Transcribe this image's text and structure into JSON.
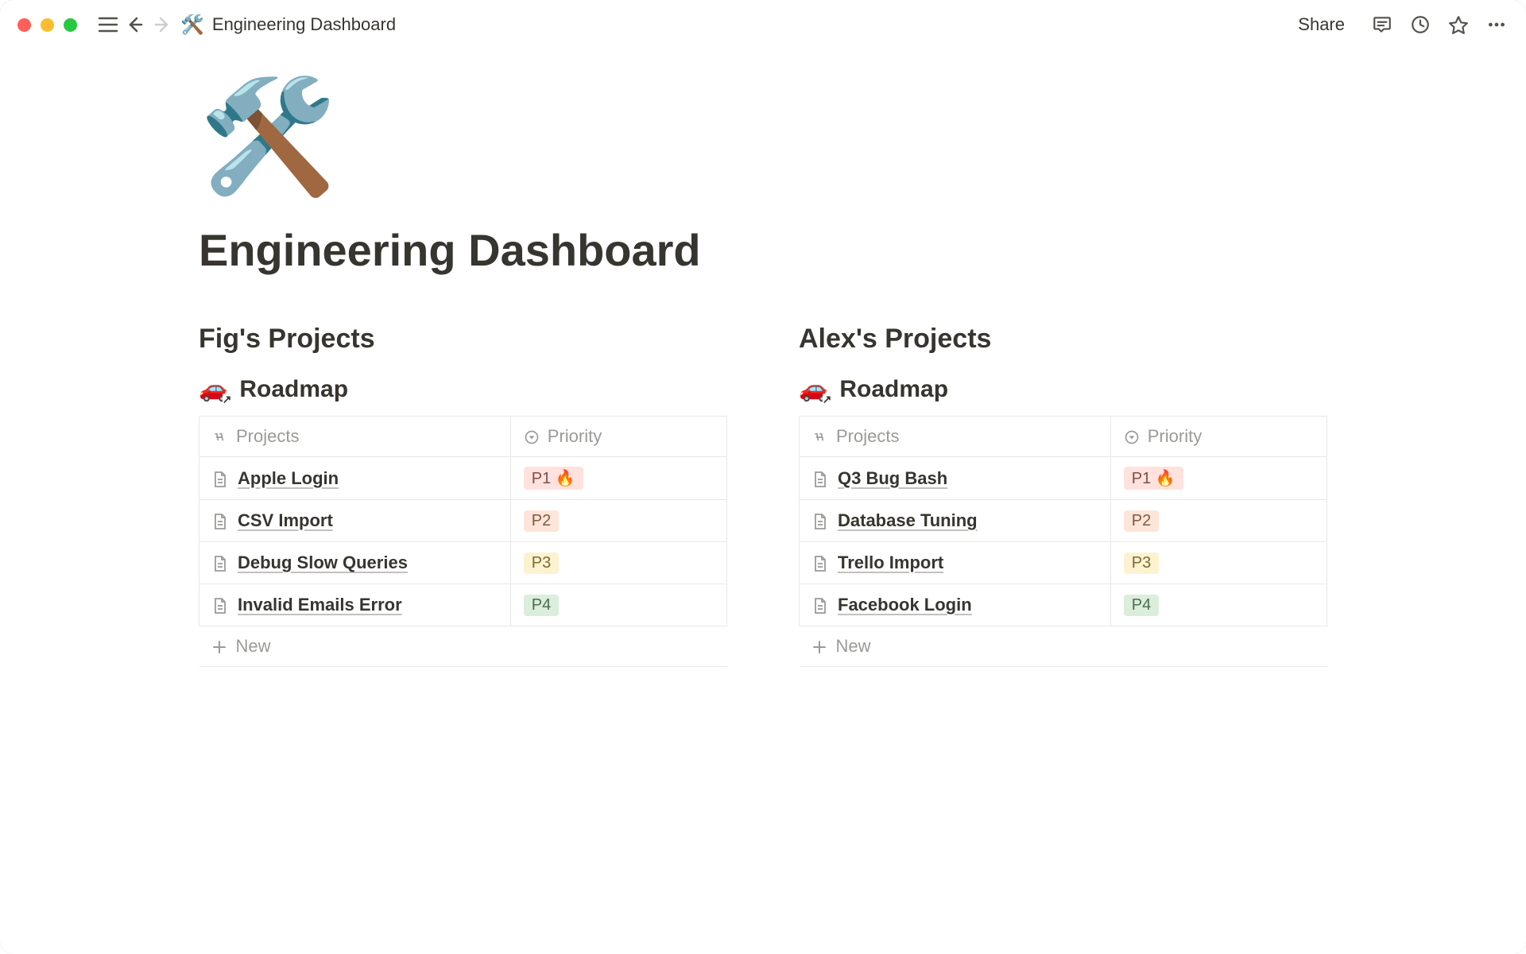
{
  "topbar": {
    "breadcrumb_icon": "🛠️",
    "breadcrumb_title": "Engineering Dashboard",
    "share_label": "Share"
  },
  "page": {
    "icon": "🛠️",
    "title": "Engineering Dashboard"
  },
  "columns": [
    {
      "heading": "Fig's Projects",
      "db": {
        "icon": "🚗",
        "title": "Roadmap",
        "cols": {
          "projects": "Projects",
          "priority": "Priority"
        },
        "rows": [
          {
            "name": "Apple Login",
            "priority": "P1 🔥",
            "pclass": "p1"
          },
          {
            "name": "CSV Import",
            "priority": "P2",
            "pclass": "p2"
          },
          {
            "name": "Debug Slow Queries",
            "priority": "P3",
            "pclass": "p3"
          },
          {
            "name": "Invalid Emails Error",
            "priority": "P4",
            "pclass": "p4"
          }
        ],
        "new_label": "New"
      }
    },
    {
      "heading": "Alex's Projects",
      "db": {
        "icon": "🚗",
        "title": "Roadmap",
        "cols": {
          "projects": "Projects",
          "priority": "Priority"
        },
        "rows": [
          {
            "name": "Q3 Bug Bash",
            "priority": "P1 🔥",
            "pclass": "p1"
          },
          {
            "name": "Database Tuning",
            "priority": "P2",
            "pclass": "p2"
          },
          {
            "name": "Trello Import",
            "priority": "P3",
            "pclass": "p3"
          },
          {
            "name": "Facebook Login",
            "priority": "P4",
            "pclass": "p4"
          }
        ],
        "new_label": "New"
      }
    }
  ]
}
